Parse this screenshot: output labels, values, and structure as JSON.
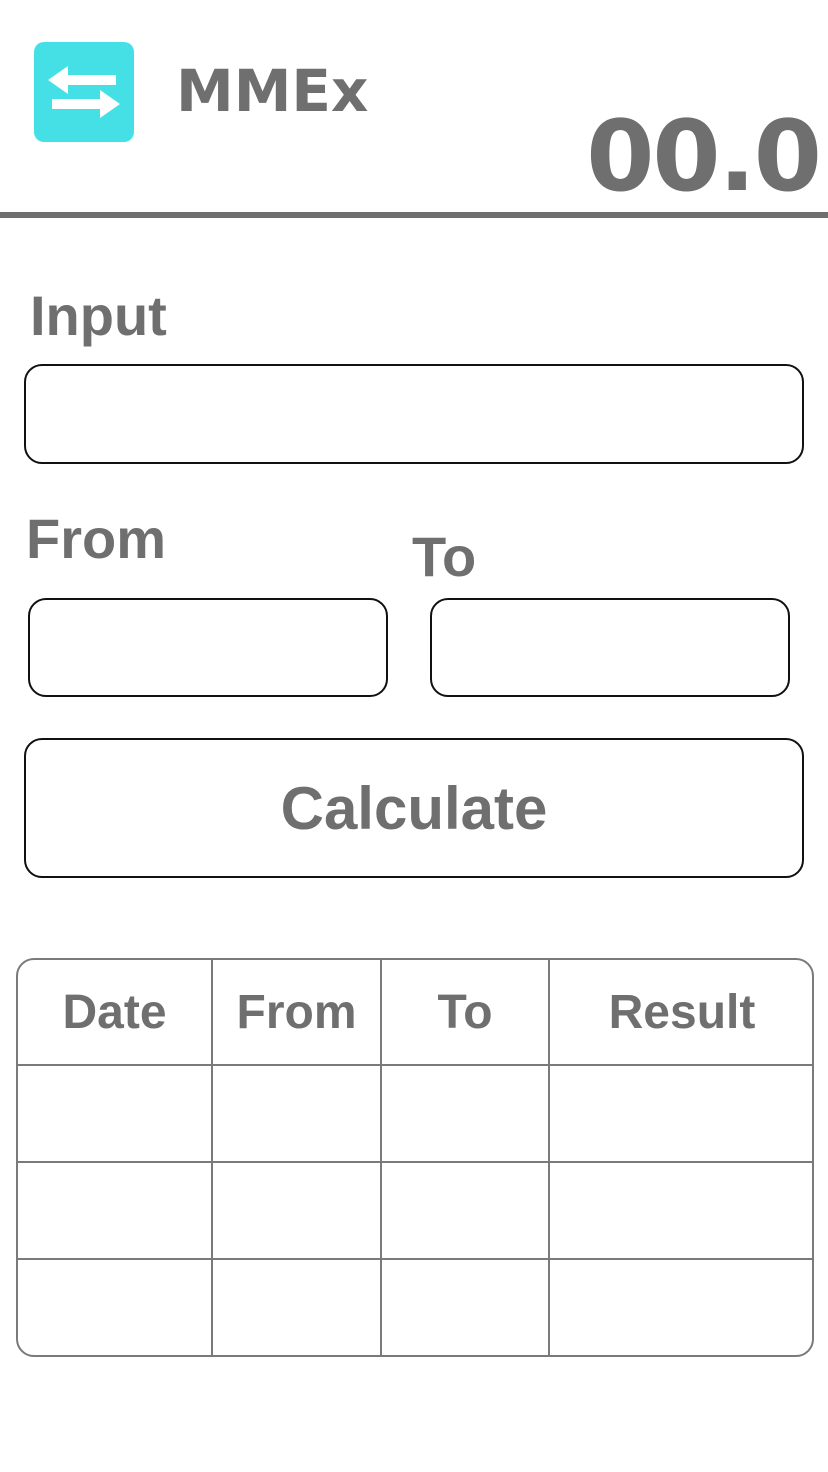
{
  "header": {
    "app_icon": "swap-arrows-icon",
    "app_icon_color": "#44e0e6",
    "title": "MMEx",
    "value": "00.0"
  },
  "form": {
    "input_label": "Input",
    "input_value": "",
    "from_label": "From",
    "from_value": "",
    "to_label": "To",
    "to_value": "",
    "calculate_label": "Calculate"
  },
  "history": {
    "columns": [
      "Date",
      "From",
      "To",
      "Result"
    ],
    "rows": [
      [
        "",
        "",
        "",
        ""
      ],
      [
        "",
        "",
        "",
        ""
      ],
      [
        "",
        "",
        "",
        ""
      ]
    ]
  },
  "colors": {
    "text": "#6f6f6f",
    "border": "#111111",
    "table_border": "#7a7a7a"
  }
}
